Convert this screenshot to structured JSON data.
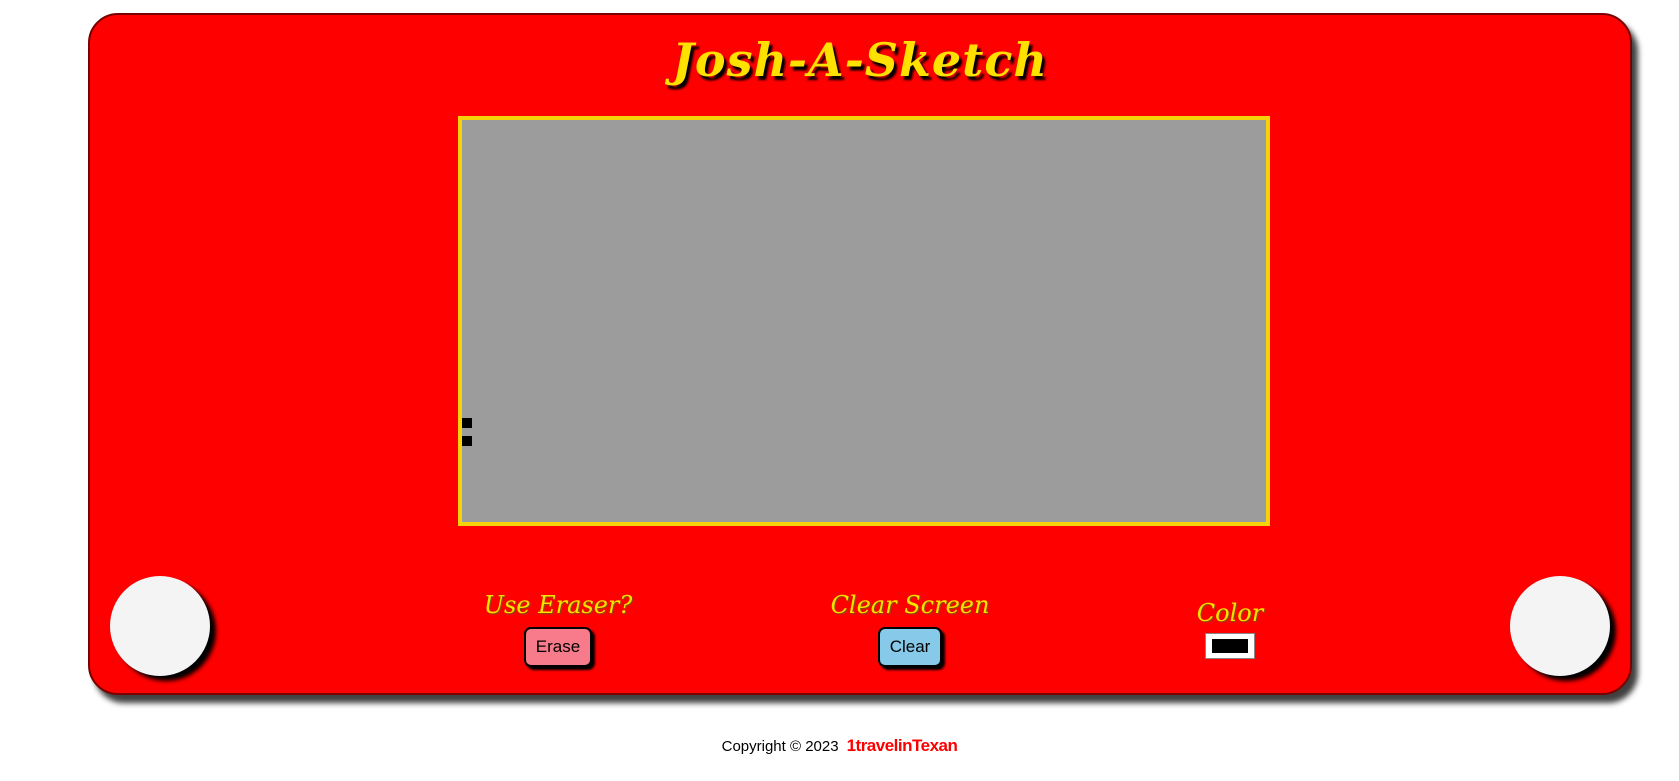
{
  "app": {
    "title": "Josh-A-Sketch"
  },
  "controls": {
    "eraser_label": "Use Eraser?",
    "erase_button": "Erase",
    "clear_label": "Clear Screen",
    "clear_button": "Clear",
    "color_label": "Color",
    "color_value": "#000000"
  },
  "footer": {
    "copyright": "Copyright © 2023",
    "author": "1travelinTexan"
  },
  "colors": {
    "frame": "#ff0000",
    "title": "#ffe100",
    "screen": "#9c9c9c",
    "screen_border": "#f5d20a",
    "erase_button": "#f77b8a",
    "clear_button": "#86c9e8"
  }
}
